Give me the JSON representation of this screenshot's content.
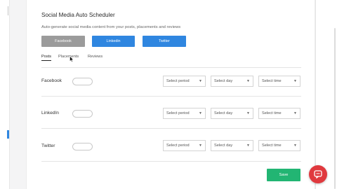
{
  "page": {
    "title": "Social Media Auto Scheduler",
    "subtitle": "Auto-generate social media content from your posts, placements and reviews"
  },
  "platform_buttons": {
    "facebook": "Facebook",
    "linkedin": "Linkedin",
    "twitter": "Twitter"
  },
  "tabs": {
    "posts": "Posts",
    "placements": "Placements",
    "reviews": "Reviews"
  },
  "rows": [
    {
      "label": "Facebook",
      "toggle_on": false,
      "period": "Select period",
      "day": "Select day",
      "time": "Select time"
    },
    {
      "label": "LinkedIn",
      "toggle_on": false,
      "period": "Select period",
      "day": "Select day",
      "time": "Select time"
    },
    {
      "label": "Twitter",
      "toggle_on": false,
      "period": "Select period",
      "day": "Select day",
      "time": "Select time"
    }
  ],
  "save_label": "Save",
  "colors": {
    "accent": "#2f86e0",
    "disabled_button": "#9b9b9b",
    "save": "#22b573",
    "chat": "#e0393e"
  },
  "icons": {
    "chat": "chat-bubble-icon",
    "caret": "caret-down-icon"
  }
}
